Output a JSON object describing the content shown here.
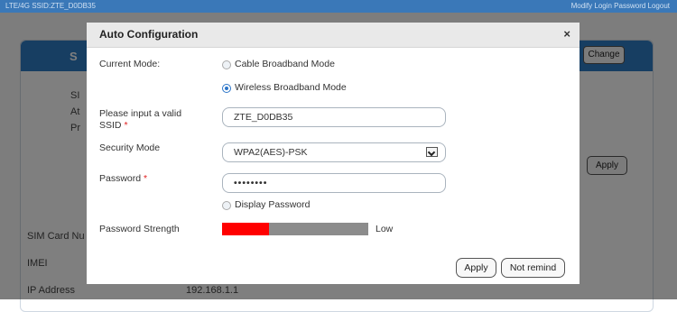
{
  "background": {
    "topbar_left": "LTE/4G SSID:ZTE_D0DB35",
    "topbar_right": "Modify Login Password  Logout",
    "panel_letter": "S",
    "fragments": [
      "SI",
      "At",
      "Pr"
    ],
    "change_label": "Change",
    "apply_label": "Apply",
    "rows": [
      {
        "label": "SIM Card Nu",
        "value": ""
      },
      {
        "label": "IMEI",
        "value": ""
      },
      {
        "label": "IP Address",
        "value": "192.168.1.1"
      }
    ]
  },
  "modal": {
    "title": "Auto Configuration",
    "close": "×",
    "current_mode_label": "Current Mode:",
    "modes": [
      {
        "label": "Cable Broadband Mode",
        "selected": false
      },
      {
        "label": "Wireless Broadband Mode",
        "selected": true
      }
    ],
    "ssid_label": "Please input a valid SSID",
    "required_mark": "*",
    "ssid_value": "ZTE_D0DB35",
    "security_label": "Security Mode",
    "security_value": "WPA2(AES)-PSK",
    "password_label": "Password",
    "password_value": "••••••••",
    "display_password_label": "Display Password",
    "strength_label": "Password Strength",
    "strength_level": 0.32,
    "strength_text": "Low",
    "apply_label": "Apply",
    "not_remind_label": "Not remind"
  },
  "colors": {
    "header_blue": "#2f7cc4",
    "strength_red": "#ff0000",
    "strength_gray": "#8c8c8c",
    "radio_blue": "#2a74c8"
  }
}
